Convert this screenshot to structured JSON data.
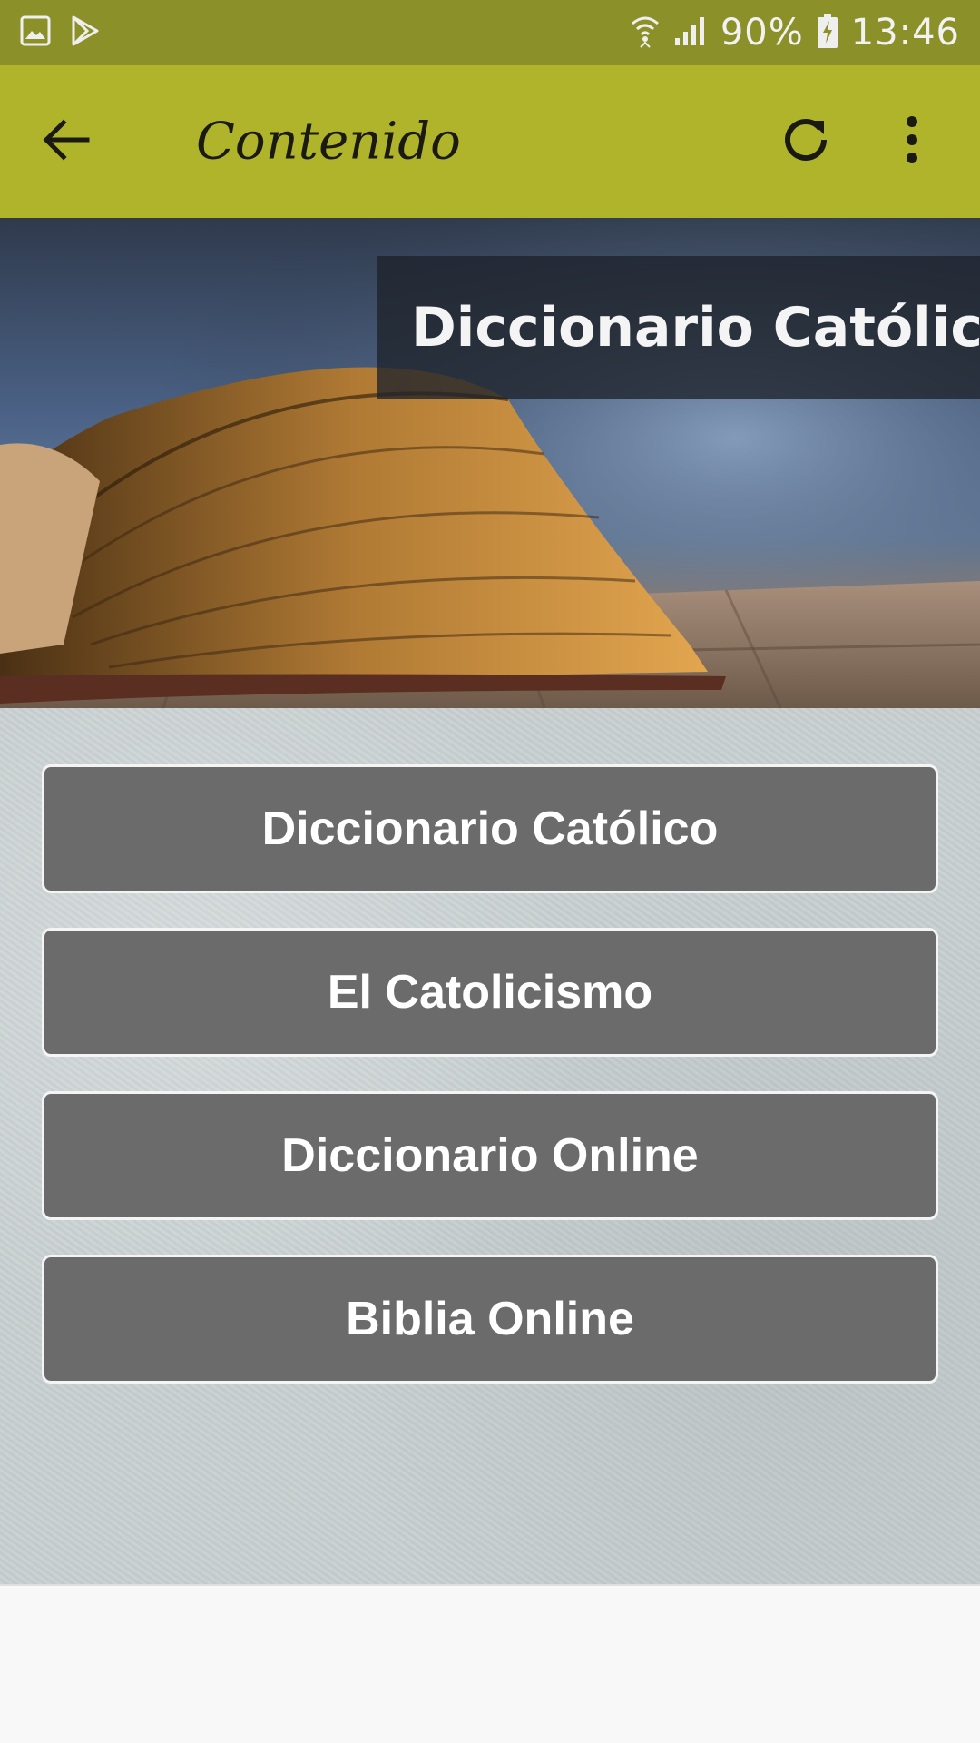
{
  "status_bar": {
    "battery": "90%",
    "time": "13:46",
    "icons": [
      "gallery-icon",
      "play-store-icon",
      "wifi-icon",
      "signal-icon",
      "battery-charging-icon"
    ]
  },
  "app_bar": {
    "title": "Contenido",
    "back_icon": "arrow-back-icon",
    "refresh_icon": "refresh-icon",
    "menu_icon": "more-vert-icon"
  },
  "banner": {
    "caption": "Diccionario Católico"
  },
  "menu": {
    "items": [
      {
        "label": "Diccionario Católico"
      },
      {
        "label": "El Catolicismo"
      },
      {
        "label": "Diccionario Online"
      },
      {
        "label": "Biblia Online"
      }
    ]
  },
  "colors": {
    "status_bar": "#8b9128",
    "app_bar": "#afb42b",
    "button": "#6b6b6b"
  }
}
